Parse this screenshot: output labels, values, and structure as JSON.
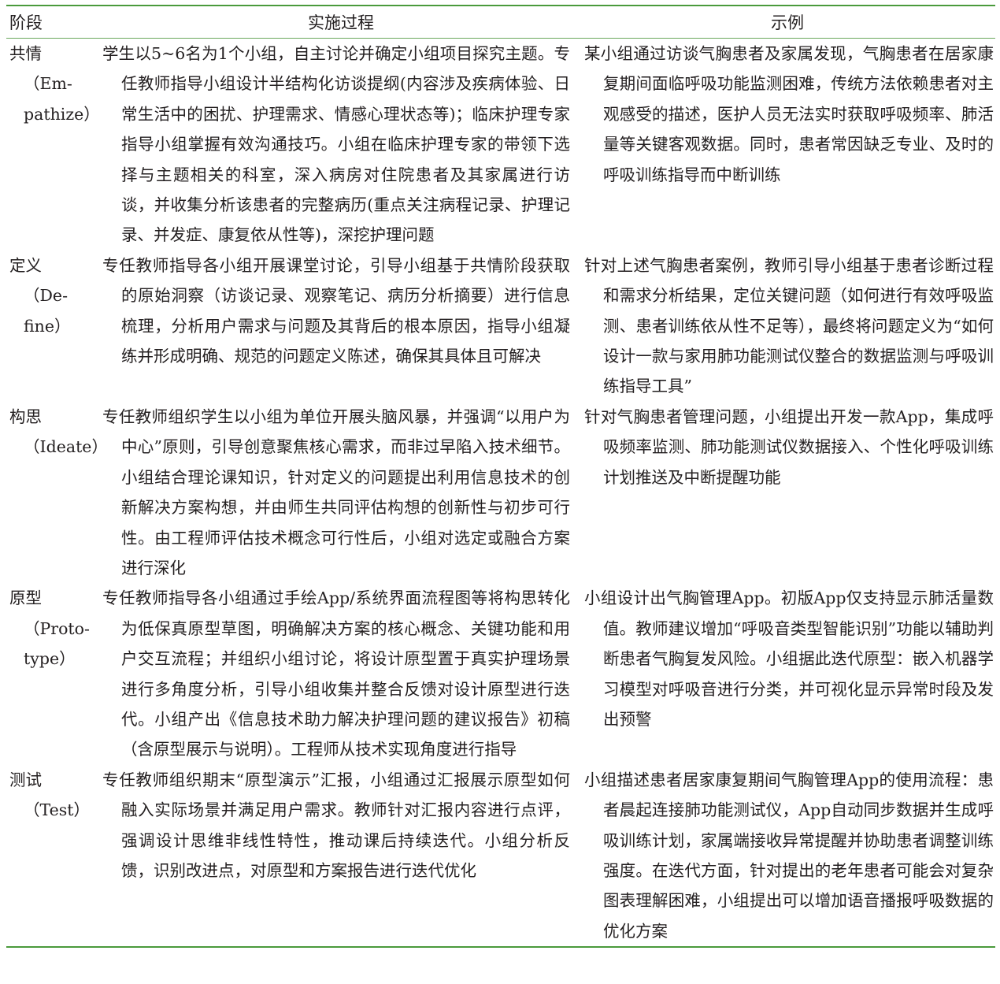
{
  "header": {
    "stage": "阶段",
    "process": "实施过程",
    "example": "示例"
  },
  "rows": [
    {
      "stage": "共情",
      "stage_en": [
        "（Em-",
        "pathize）"
      ],
      "process": "学生以5~6名为1个小组，自主讨论并确定小组项目探究主题。专任教师指导小组设计半结构化访谈提纲(内容涉及疾病体验、日常生活中的困扰、护理需求、情感心理状态等)；临床护理专家指导小组掌握有效沟通技巧。小组在临床护理专家的带领下选择与主题相关的科室，深入病房对住院患者及其家属进行访谈，并收集分析该患者的完整病历(重点关注病程记录、护理记录、并发症、康复依从性等)，深挖护理问题",
      "example": "某小组通过访谈气胸患者及家属发现，气胸患者在居家康复期间面临呼吸功能监测困难，传统方法依赖患者对主观感受的描述，医护人员无法实时获取呼吸频率、肺活量等关键客观数据。同时，患者常因缺乏专业、及时的呼吸训练指导而中断训练"
    },
    {
      "stage": "定义",
      "stage_en": [
        "（De-",
        "fine）"
      ],
      "process": "专任教师指导各小组开展课堂讨论，引导小组基于共情阶段获取的原始洞察（访谈记录、观察笔记、病历分析摘要）进行信息梳理，分析用户需求与问题及其背后的根本原因，指导小组凝练并形成明确、规范的问题定义陈述，确保其具体且可解决",
      "example": "针对上述气胸患者案例，教师引导小组基于患者诊断过程和需求分析结果，定位关键问题（如何进行有效呼吸监测、患者训练依从性不足等），最终将问题定义为“如何设计一款与家用肺功能测试仪整合的数据监测与呼吸训练指导工具”"
    },
    {
      "stage": "构思",
      "stage_en": [
        "（Ideate）"
      ],
      "process": "专任教师组织学生以小组为单位开展头脑风暴，并强调“以用户为中心”原则，引导创意聚焦核心需求，而非过早陷入技术细节。小组结合理论课知识，针对定义的问题提出利用信息技术的创新解决方案构想，并由师生共同评估构想的创新性与初步可行性。由工程师评估技术概念可行性后，小组对选定或融合方案进行深化",
      "example": "针对气胸患者管理问题，小组提出开发一款App，集成呼吸频率监测、肺功能测试仪数据接入、个性化呼吸训练计划推送及中断提醒功能"
    },
    {
      "stage": "原型",
      "stage_en": [
        "（Proto-",
        "type）"
      ],
      "process": "专任教师指导各小组通过手绘App/系统界面流程图等将构思转化为低保真原型草图，明确解决方案的核心概念、关键功能和用户交互流程；并组织小组讨论，将设计原型置于真实护理场景进行多角度分析，引导小组收集并整合反馈对设计原型进行迭代。小组产出《信息技术助力解决护理问题的建议报告》初稿（含原型展示与说明）。工程师从技术实现角度进行指导",
      "example": "小组设计出气胸管理App。初版App仅支持显示肺活量数值。教师建议增加“呼吸音类型智能识别”功能以辅助判断患者气胸复发风险。小组据此迭代原型：嵌入机器学习模型对呼吸音进行分类，并可视化显示异常时段及发出预警"
    },
    {
      "stage": "测试",
      "stage_en": [
        "（Test）"
      ],
      "process": "专任教师组织期末“原型演示”汇报，小组通过汇报展示原型如何融入实际场景并满足用户需求。教师针对汇报内容进行点评，强调设计思维非线性特性，推动课后持续迭代。小组分析反馈，识别改进点，对原型和方案报告进行迭代优化",
      "example": "小组描述患者居家康复期间气胸管理App的使用流程：患者晨起连接肺功能测试仪，App自动同步数据并生成呼吸训练计划，家属端接收异常提醒并协助患者调整训练强度。在迭代方面，针对提出的老年患者可能会对复杂图表理解困难，小组提出可以增加语音播报呼吸数据的优化方案"
    }
  ]
}
